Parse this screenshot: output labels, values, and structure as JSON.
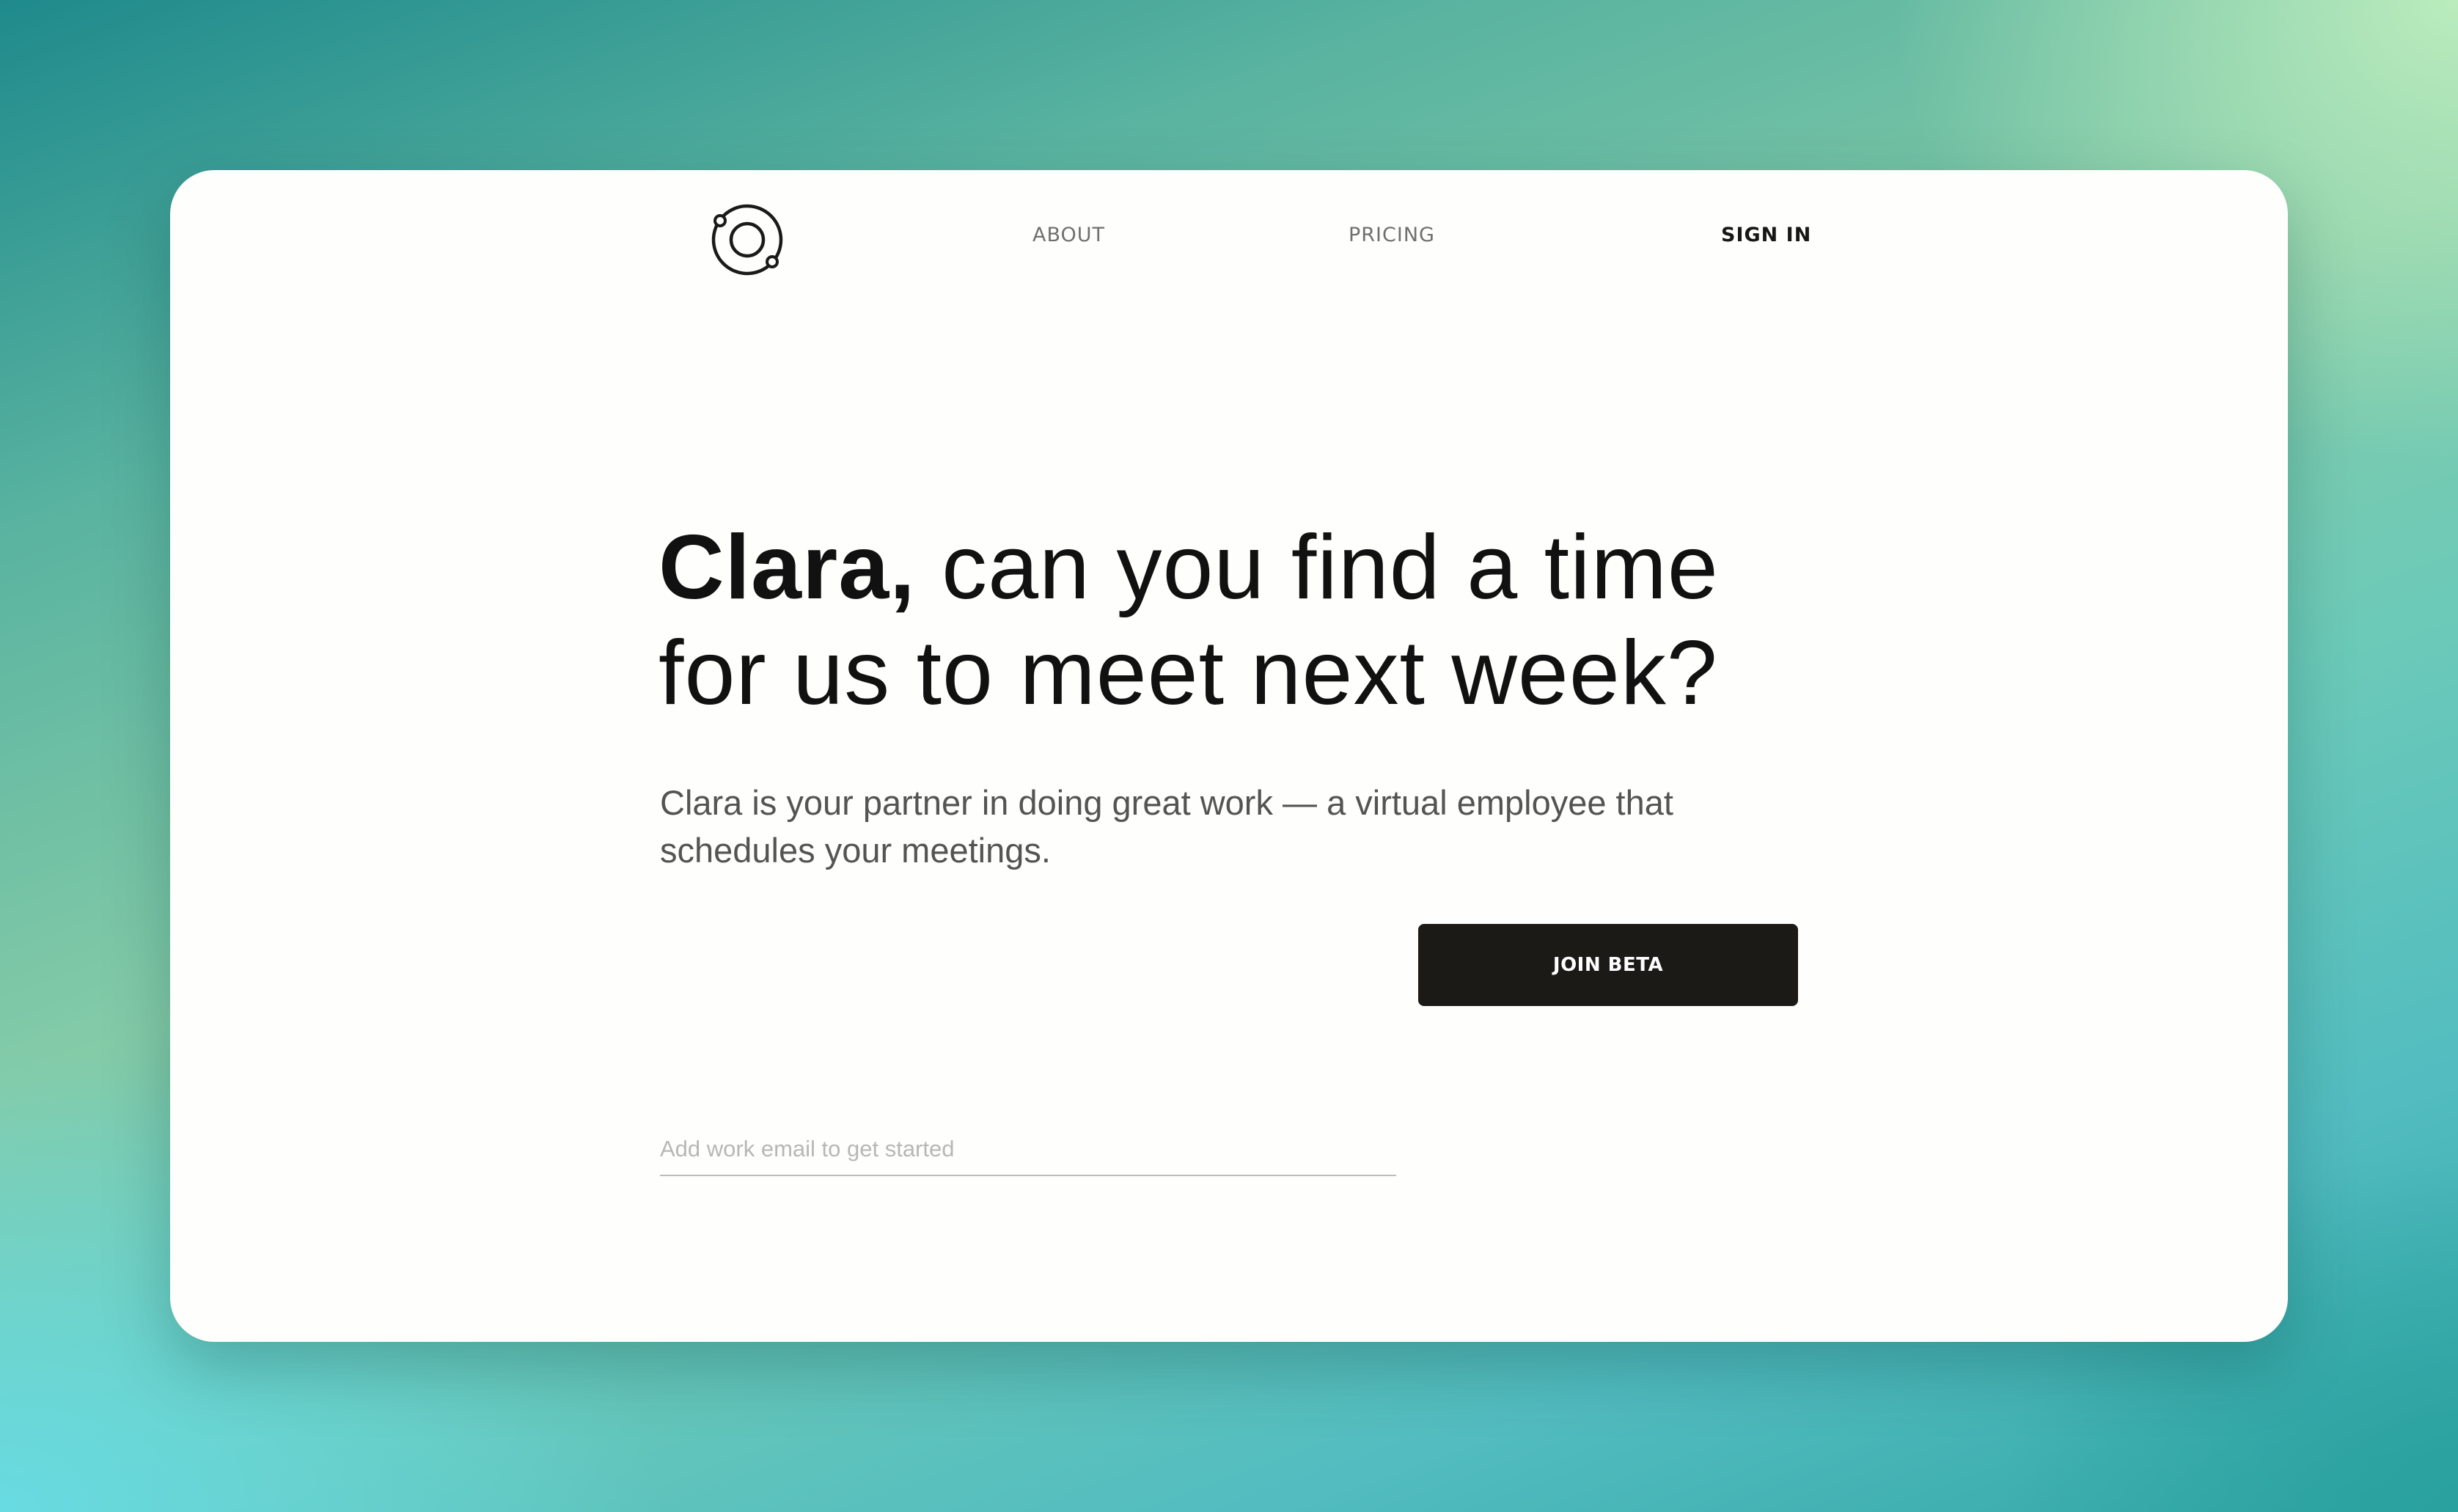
{
  "nav": {
    "logo_icon": "orbit-logo-icon",
    "about_label": "ABOUT",
    "pricing_label": "PRICING",
    "signin_label": "SIGN IN"
  },
  "hero": {
    "headline_strong": "Clara,",
    "headline_rest": " can you find a time for us to meet next week?",
    "subtitle": "Clara is your partner in doing great work — a virtual employee that schedules your meetings.",
    "email_placeholder": "Add work email to get started",
    "cta_label": "JOIN BETA"
  },
  "colors": {
    "button_background": "#1b1a17",
    "card_background": "#fefefc",
    "headline_text": "#111111",
    "subtitle_text": "#545454"
  }
}
